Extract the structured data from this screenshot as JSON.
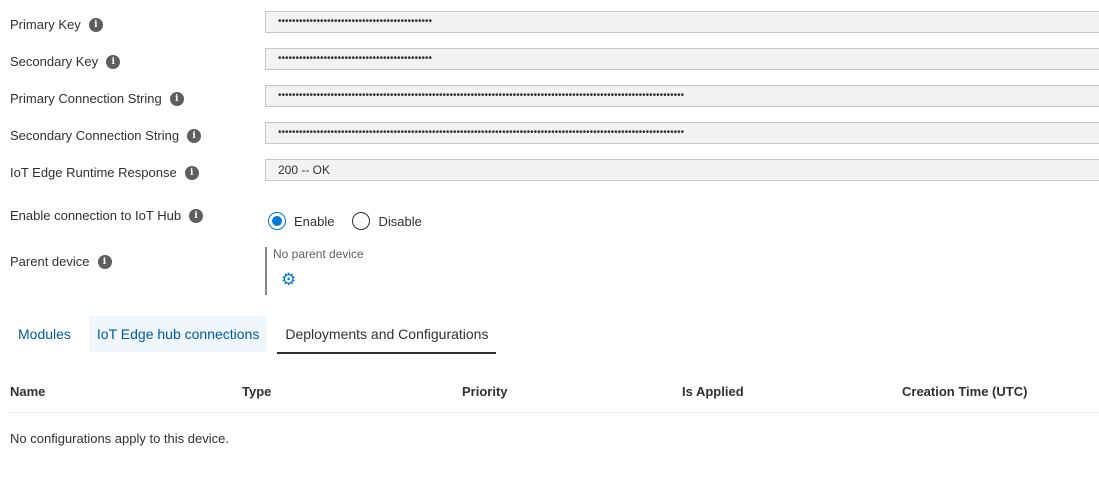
{
  "fields": [
    {
      "label": "Primary Key",
      "value": "••••••••••••••••••••••••••••••••••••••••••••",
      "masked": true
    },
    {
      "label": "Secondary Key",
      "value": "••••••••••••••••••••••••••••••••••••••••••••",
      "masked": true
    },
    {
      "label": "Primary Connection String",
      "value": "••••••••••••••••••••••••••••••••••••••••••••••••••••••••••••••••••••••••••••••••••••••••••••••••••••••••••••••••••••",
      "masked": true
    },
    {
      "label": "Secondary Connection String",
      "value": "••••••••••••••••••••••••••••••••••••••••••••••••••••••••••••••••••••••••••••••••••••••••••••••••••••••••••••••••••••",
      "masked": true
    },
    {
      "label": "IoT Edge Runtime Response",
      "value": "200 -- OK",
      "masked": false
    }
  ],
  "connection": {
    "label": "Enable connection to IoT Hub",
    "options": [
      {
        "label": "Enable",
        "selected": true
      },
      {
        "label": "Disable",
        "selected": false
      }
    ]
  },
  "parent": {
    "label": "Parent device",
    "value": "No parent device",
    "icon": "gear-icon"
  },
  "tabs": [
    {
      "label": "Modules",
      "state": "normal"
    },
    {
      "label": "IoT Edge hub connections",
      "state": "hover"
    },
    {
      "label": "Deployments and Configurations",
      "state": "active"
    }
  ],
  "table": {
    "columns": [
      "Name",
      "Type",
      "Priority",
      "Is Applied",
      "Creation Time (UTC)"
    ],
    "empty_message": "No configurations apply to this device."
  },
  "colors": {
    "accent": "#0078d4",
    "text": "#323130",
    "field_bg": "#f3f2f1"
  }
}
